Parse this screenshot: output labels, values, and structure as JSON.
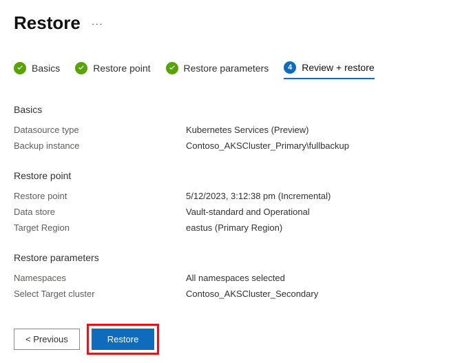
{
  "header": {
    "title": "Restore"
  },
  "steps": {
    "basics": "Basics",
    "restorePoint": "Restore point",
    "restoreParams": "Restore parameters",
    "review": {
      "num": "4",
      "label": "Review + restore"
    }
  },
  "sections": {
    "basics": {
      "title": "Basics",
      "rows": {
        "datasourceType": {
          "label": "Datasource type",
          "value": "Kubernetes Services (Preview)"
        },
        "backupInstance": {
          "label": "Backup instance",
          "value": "Contoso_AKSCluster_Primary\\fullbackup"
        }
      }
    },
    "restorePoint": {
      "title": "Restore point",
      "rows": {
        "restorePoint": {
          "label": "Restore point",
          "value": "5/12/2023, 3:12:38 pm (Incremental)"
        },
        "dataStore": {
          "label": "Data store",
          "value": "Vault-standard and Operational"
        },
        "targetRegion": {
          "label": "Target Region",
          "value": "eastus (Primary Region)"
        }
      }
    },
    "restoreParams": {
      "title": "Restore parameters",
      "rows": {
        "namespaces": {
          "label": "Namespaces",
          "value": "All namespaces selected"
        },
        "targetCluster": {
          "label": "Select Target cluster",
          "value": "Contoso_AKSCluster_Secondary"
        }
      }
    }
  },
  "footer": {
    "previous": "< Previous",
    "restore": "Restore"
  }
}
